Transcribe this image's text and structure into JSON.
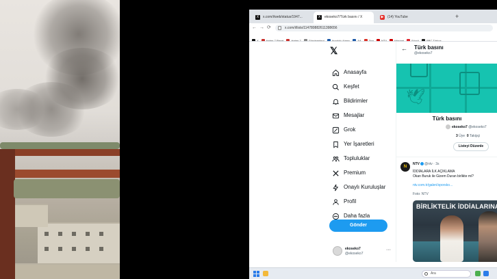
{
  "browser": {
    "tabs": [
      {
        "label": "x.com/i/web/status/1947...",
        "icon": "x-icon",
        "active": false
      },
      {
        "label": "ekoseko7/Türk basını / X",
        "icon": "x-icon",
        "active": true
      },
      {
        "label": "(14) YouTube",
        "icon": "youtube-icon",
        "active": false
      }
    ],
    "new_tab": "+",
    "url": "x.com/i/lists/1147808826113986​56",
    "bookmarks": [
      "X",
      "Haber 7 Reset",
      "Haber 7",
      "Gündemdegi",
      "Anadolu Ajansı",
      "AA",
      "Dha",
      "NTV",
      "Hürriyet",
      "Sözcü",
      "BBC Türkçe"
    ],
    "bookmark_colors": [
      "#111111",
      "#c9302c",
      "#c9302c",
      "#888888",
      "#1e5aa8",
      "#1e5aa8",
      "#d93025",
      "#cc0000",
      "#cc0000",
      "#e0262f",
      "#222222"
    ]
  },
  "x_nav": {
    "logo": "𝕏",
    "items": [
      {
        "label": "Anasayfa",
        "icon": "home-icon"
      },
      {
        "label": "Keşfet",
        "icon": "search-icon"
      },
      {
        "label": "Bildirimler",
        "icon": "bell-icon"
      },
      {
        "label": "Mesajlar",
        "icon": "mail-icon"
      },
      {
        "label": "Grok",
        "icon": "grok-icon"
      },
      {
        "label": "Yer İşaretleri",
        "icon": "bookmark-icon"
      },
      {
        "label": "Topluluklar",
        "icon": "communities-icon"
      },
      {
        "label": "Premium",
        "icon": "x-premium-icon"
      },
      {
        "label": "Onaylı Kuruluşlar",
        "icon": "lightning-icon"
      },
      {
        "label": "Profil",
        "icon": "person-icon"
      },
      {
        "label": "Daha fazla",
        "icon": "more-circle-icon"
      }
    ],
    "post_button": "Gönder",
    "account": {
      "name": "ekoseko7",
      "handle": "@ekoseko7",
      "more": "···"
    }
  },
  "list": {
    "back": "←",
    "header_title": "Türk basını",
    "header_handle": "@ekoseko7",
    "title": "Türk basını",
    "owner_name": "ekoseko7",
    "owner_handle": "@ekoseko7",
    "members_count": "3",
    "members_label": "Üye",
    "followers_count": "0",
    "followers_label": "Takipçi",
    "edit_button": "Listeyi Düzenle"
  },
  "tweet": {
    "avatar_text": "N",
    "author": "NTV",
    "handle": "@ntv · 3s",
    "line1": "İDDİALARA İLK AÇIKLAMA",
    "line2": "Okan Buruk ile Gizem Duran birlikte mi?",
    "link": "ntv.com.tr/galeri/sporsko...",
    "photo_credit": "Foto: NTV",
    "media_caption": "BİRLİKTELİK İDDİALARINA"
  },
  "taskbar": {
    "search_placeholder": "Ara"
  },
  "colors": {
    "accent": "#1d9bf0",
    "banner": "#16c3b0",
    "railing": "#8a3f27"
  }
}
